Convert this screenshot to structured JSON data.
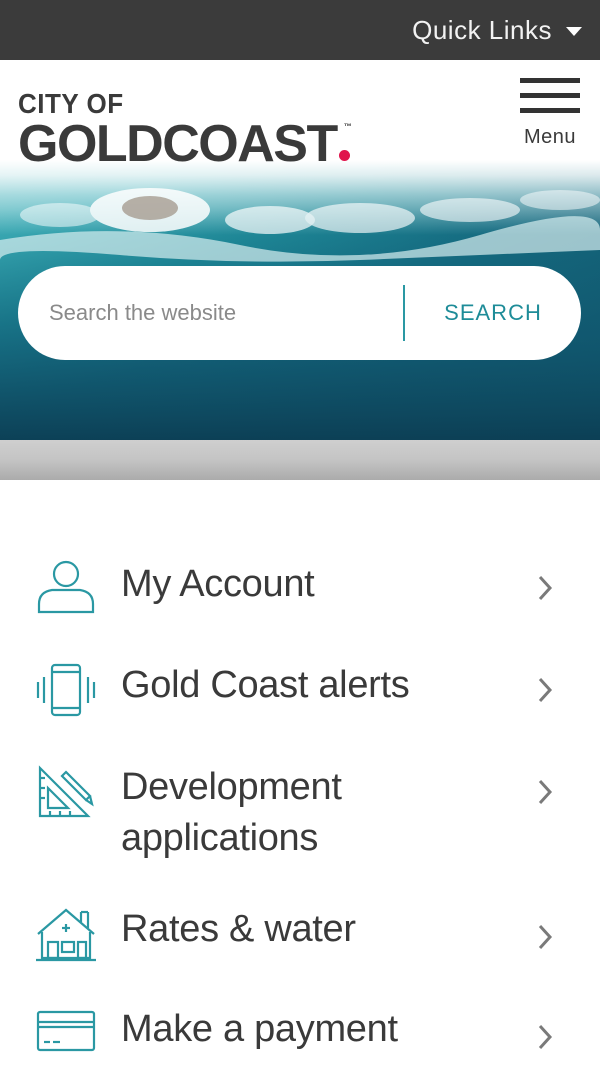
{
  "topbar": {
    "quick_links_label": "Quick Links",
    "quick_links_icon": "caret-down-icon"
  },
  "header": {
    "logo_line1": "CITY OF",
    "logo_line2": "GOLDCOAST",
    "logo_tm": "™",
    "menu_label": "Menu",
    "menu_icon": "hamburger-icon"
  },
  "search": {
    "placeholder": "Search the website",
    "button_label": "SEARCH"
  },
  "colors": {
    "accent": "#2a98a3",
    "brand_dot": "#e0144c",
    "topbar": "#3b3b3b",
    "text": "#3a3a3a"
  },
  "nav": {
    "items": [
      {
        "label": "My Account",
        "icon": "user-icon"
      },
      {
        "label": "Gold Coast alerts",
        "icon": "mobile-alert-icon"
      },
      {
        "label": "Development",
        "label2": "applications",
        "icon": "drafting-tools-icon"
      },
      {
        "label": "Rates & water",
        "icon": "house-icon"
      },
      {
        "label": "Make a payment",
        "icon": "credit-card-icon"
      }
    ]
  }
}
